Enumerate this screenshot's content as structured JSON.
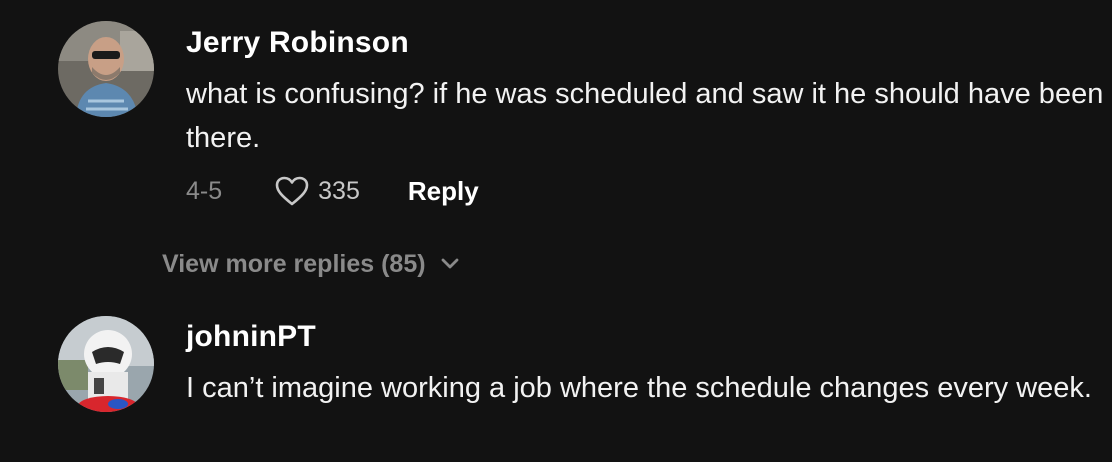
{
  "colors": {
    "background": "#121212",
    "username": "#ffffff",
    "body_text": "#f2f2f2",
    "muted": "#8a8a8a"
  },
  "comments": [
    {
      "username": "Jerry Robinson",
      "text": "what is confusing? if he was scheduled and saw it he should have been there.",
      "date": "4-5",
      "likes": "335",
      "reply_label": "Reply",
      "like_icon": "heart-outline-icon"
    },
    {
      "username": "johninPT",
      "text": "I can’t imagine working a job where the schedule changes every week."
    }
  ],
  "view_more": {
    "label": "View more replies (85)",
    "icon": "chevron-down-icon"
  }
}
